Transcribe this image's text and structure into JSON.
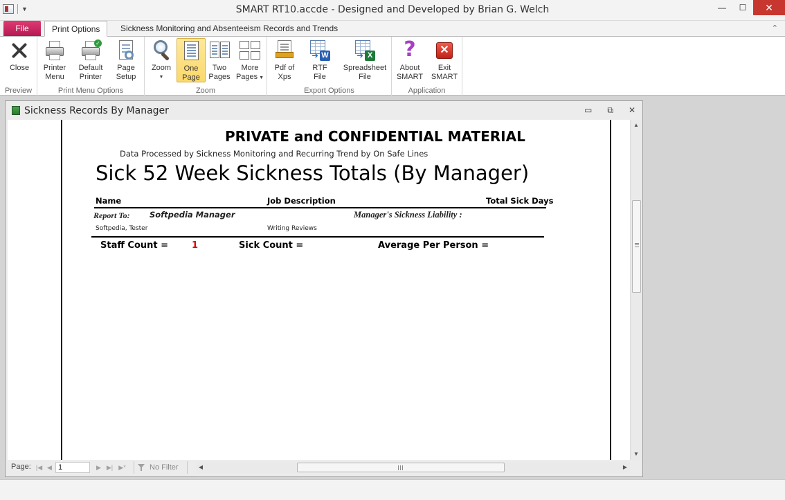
{
  "app": {
    "title": "SMART RT10.accde - Designed and Developed by Brian G. Welch",
    "window_controls": {
      "minimize": "—",
      "maximize": "☐",
      "close": "✕"
    }
  },
  "ribbon": {
    "file_tab": "File",
    "tabs": [
      "Print Options",
      "Sickness Monitoring and Absenteeism Records and Trends"
    ],
    "active_tab": "Print Options",
    "minimize_icon": "⌃",
    "groups": {
      "preview": {
        "label": "Preview",
        "close": "Close"
      },
      "print_menu": {
        "label": "Print Menu Options",
        "printer_menu": [
          "Printer",
          "Menu"
        ],
        "default_printer": [
          "Default",
          "Printer"
        ],
        "page_setup": [
          "Page",
          "Setup"
        ]
      },
      "zoom": {
        "label": "Zoom",
        "zoom": "Zoom",
        "one_page": [
          "One",
          "Page"
        ],
        "two_pages": [
          "Two",
          "Pages"
        ],
        "more_pages": [
          "More",
          "Pages"
        ]
      },
      "export": {
        "label": "Export Options",
        "pdf": [
          "Pdf of",
          "Xps"
        ],
        "rtf": [
          "RTF",
          "File"
        ],
        "spreadsheet": [
          "Spreadsheet",
          "File"
        ]
      },
      "application": {
        "label": "Application",
        "about": [
          "About",
          "SMART"
        ],
        "exit": [
          "Exit",
          "SMART"
        ]
      }
    },
    "badges": {
      "word": "W",
      "excel": "X",
      "exit_mark": "✕",
      "about_mark": "?"
    }
  },
  "document": {
    "window_title": "Sickness Records By Manager",
    "controls": {
      "minimize": "▭",
      "restore": "⧉",
      "close": "✕"
    },
    "report": {
      "confidential": "PRIVATE and CONFIDENTIAL MATERIAL",
      "processed_by": "Data Processed by Sickness Monitoring and Recurring Trend  by On Safe Lines",
      "title": "Sick 52 Week Sickness Totals (By Manager)",
      "columns": {
        "name": "Name",
        "job": "Job Description",
        "total": "Total Sick Days"
      },
      "report_to_label": "Report To:",
      "report_to_value": "Softpedia Manager",
      "liability_label": "Manager's Sickness Liability  :",
      "row": {
        "name": "Softpedia, Tester",
        "job": "Writing Reviews"
      },
      "summary": {
        "staff_count_label": "Staff Count =",
        "staff_count_value": "1",
        "sick_count_label": "Sick Count =",
        "average_label": "Average Per Person ="
      }
    },
    "navigation": {
      "page_label": "Page:",
      "page_value": "1",
      "filter_label": "No Filter"
    }
  },
  "colors": {
    "file_tab": "#c8205c",
    "selected_button": "#fbd86a",
    "staff_count_value": "#e00000",
    "exit_button": "#d63a2e",
    "about_icon": "#a63fc6"
  }
}
